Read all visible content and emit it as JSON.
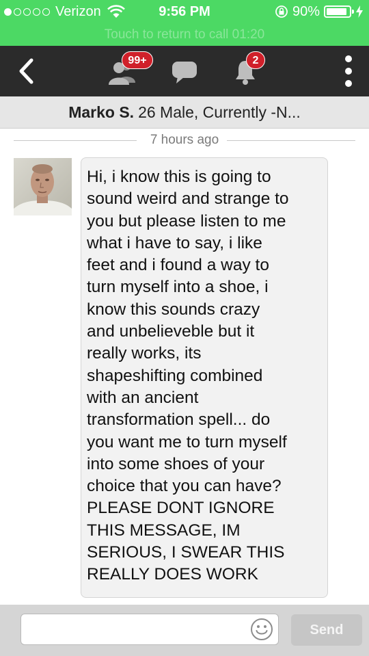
{
  "status_bar": {
    "carrier": "Verizon",
    "time": "9:56 PM",
    "battery": "90%",
    "signal_dots_filled": 1,
    "signal_dots_total": 5
  },
  "call_banner": {
    "text": "Touch to return to call  01:20"
  },
  "navbar": {
    "friends_badge": "99+",
    "notifications_badge": "2",
    "icons": [
      "chevron-left-icon",
      "friends-icon",
      "chat-bubble-icon",
      "bell-icon",
      "more-vertical-icon"
    ]
  },
  "profile": {
    "name": "Marko S.",
    "details": "26 Male, Currently -N..."
  },
  "conversation": {
    "timestamp": "7 hours ago",
    "messages": [
      {
        "text": "Hi, i know this is going to\nsound weird and strange to\nyou but please listen to me\nwhat i have to say, i like\nfeet and i found a way to\nturn myself into a shoe, i\nknow this sounds crazy\nand unbelieveble but it\nreally works, its\nshapeshifting combined\nwith an ancient\ntransformation spell... do\nyou want me to turn myself\ninto some shoes of your\nchoice that you can have?\nPLEASE DONT IGNORE\nTHIS MESSAGE, IM\nSERIOUS, I SWEAR THIS\nREALLY DOES WORK"
      }
    ]
  },
  "composer": {
    "input_value": "",
    "send_label": "Send"
  },
  "colors": {
    "call_green": "#4cd964",
    "navbar_bg": "#2b2b2b",
    "badge_red": "#d0202a",
    "header_bg": "#e6e6e6",
    "bubble_bg": "#f2f2f2"
  }
}
